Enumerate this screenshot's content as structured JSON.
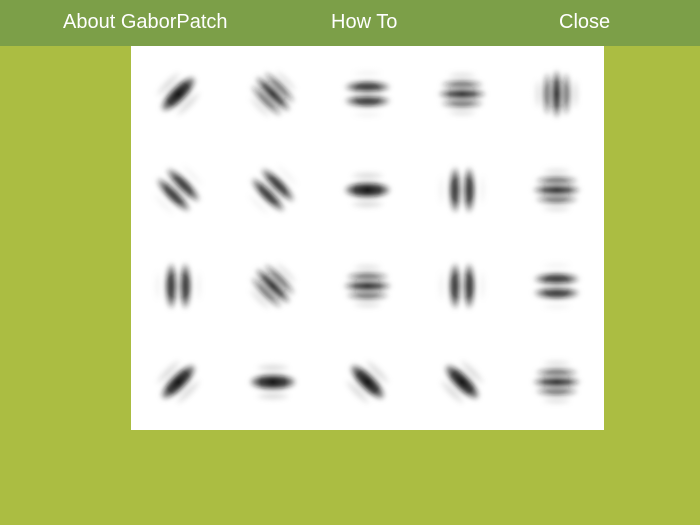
{
  "nav": {
    "about_label": "About GaborPatch",
    "howto_label": "How To",
    "close_label": "Close"
  },
  "colors": {
    "background": "#abbd42",
    "top_bar": "#7c9f48",
    "nav_text": "#ffffff",
    "board": "#ffffff",
    "patch_ink": "#111111"
  },
  "icons": {
    "patch": "gabor-patch"
  },
  "grid": {
    "rows": 4,
    "columns": 5,
    "patches": [
      {
        "orientation_deg": -45,
        "cycles": "low"
      },
      {
        "orientation_deg": 45,
        "cycles": "high"
      },
      {
        "orientation_deg": 0,
        "cycles": "medium"
      },
      {
        "orientation_deg": 0,
        "cycles": "high"
      },
      {
        "orientation_deg": 90,
        "cycles": "high"
      },
      {
        "orientation_deg": 45,
        "cycles": "medium"
      },
      {
        "orientation_deg": 45,
        "cycles": "medium"
      },
      {
        "orientation_deg": 0,
        "cycles": "low"
      },
      {
        "orientation_deg": 90,
        "cycles": "medium"
      },
      {
        "orientation_deg": 0,
        "cycles": "high"
      },
      {
        "orientation_deg": 90,
        "cycles": "medium"
      },
      {
        "orientation_deg": 45,
        "cycles": "high"
      },
      {
        "orientation_deg": 0,
        "cycles": "high"
      },
      {
        "orientation_deg": 90,
        "cycles": "medium"
      },
      {
        "orientation_deg": 0,
        "cycles": "medium"
      },
      {
        "orientation_deg": -45,
        "cycles": "low"
      },
      {
        "orientation_deg": 0,
        "cycles": "low"
      },
      {
        "orientation_deg": 45,
        "cycles": "low"
      },
      {
        "orientation_deg": 45,
        "cycles": "low"
      },
      {
        "orientation_deg": 0,
        "cycles": "high"
      }
    ]
  }
}
